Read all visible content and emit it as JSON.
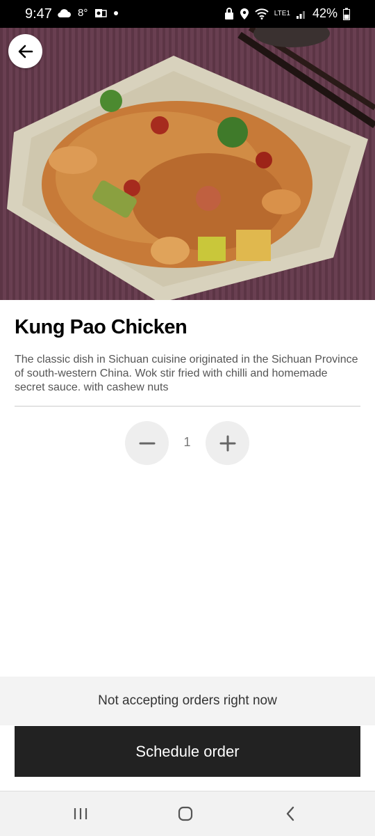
{
  "status_bar": {
    "time": "9:47",
    "temperature": "8°",
    "battery_percent": "42%",
    "network_label": "LTE1"
  },
  "product": {
    "name": "Kung Pao Chicken",
    "description": "The classic dish in Sichuan cuisine originated in the Sichuan Province of south-western China. Wok stir fried with chilli and homemade secret sauce. with cashew nuts",
    "image_icon": "food-photo"
  },
  "quantity": {
    "value": "1"
  },
  "notice": {
    "text": "Not accepting orders right now"
  },
  "actions": {
    "schedule_label": "Schedule order"
  },
  "icons": {
    "back": "arrow-left-icon",
    "minus": "minus-icon",
    "plus": "plus-icon",
    "nav_recent": "recent-apps-icon",
    "nav_home": "home-icon",
    "nav_back": "chevron-left-icon"
  },
  "colors": {
    "button_dark": "#222222",
    "stepper_bg": "#eeeeee",
    "notice_bg": "#f3f3f3"
  }
}
